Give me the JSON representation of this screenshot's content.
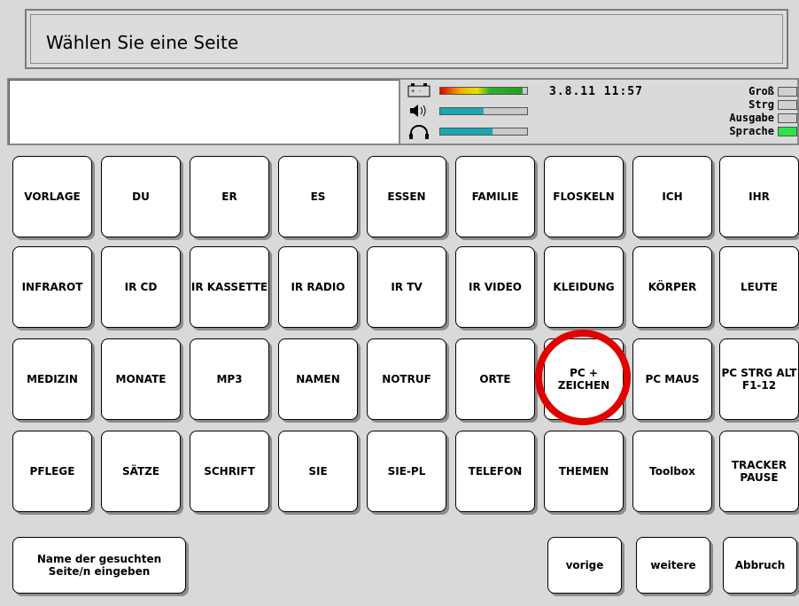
{
  "header": {
    "title": "Wählen Sie eine Seite"
  },
  "status": {
    "datetime": "3.8.11 11:57",
    "battery_level": 0.95,
    "volume_level": 0.5,
    "headphone_level": 0.6,
    "flags": [
      {
        "label": "Groß",
        "on": false
      },
      {
        "label": "Strg",
        "on": false
      },
      {
        "label": "Ausgabe",
        "on": false
      },
      {
        "label": "Sprache",
        "on": true
      }
    ]
  },
  "grid": [
    [
      "VORLAGE",
      "DU",
      "ER",
      "ES",
      "ESSEN",
      "FAMILIE",
      "FLOSKELN",
      "ICH",
      "IHR"
    ],
    [
      "INFRAROT",
      "IR CD",
      "IR KASSETTE",
      "IR RADIO",
      "IR TV",
      "IR VIDEO",
      "KLEIDUNG",
      "KÖRPER",
      "LEUTE"
    ],
    [
      "MEDIZIN",
      "MONATE",
      "MP3",
      "NAMEN",
      "NOTRUF",
      "ORTE",
      "PC +\nZEICHEN",
      "PC MAUS",
      "PC STRG ALT\nF1-12"
    ],
    [
      "PFLEGE",
      "SÄTZE",
      "SCHRIFT",
      "SIE",
      "SIE-PL",
      "TELEFON",
      "THEMEN",
      "Toolbox",
      "TRACKER\nPAUSE"
    ]
  ],
  "footer": {
    "search": "Name der gesuchten\nSeite/n eingeben",
    "prev": "vorige",
    "next": "weitere",
    "cancel": "Abbruch"
  },
  "colors": {
    "highlight_ring": "#e00000",
    "active_flag": "#2ee34a"
  }
}
